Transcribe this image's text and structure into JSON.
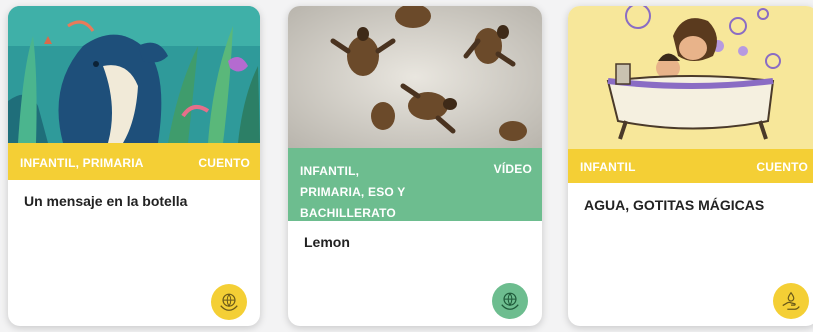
{
  "cards": [
    {
      "levels": "INFANTIL, PRIMARIA",
      "type": "CUENTO",
      "title": "Un mensaje en la botella",
      "band_color": "#f4cf35",
      "icon": "globe-hands-icon"
    },
    {
      "levels": "INFANTIL, PRIMARIA, ESO Y BACHILLERATO",
      "type": "VÍDEO",
      "title": "Lemon",
      "band_color": "#6dbd8f",
      "icon": "globe-hands-icon"
    },
    {
      "levels": "INFANTIL",
      "type": "CUENTO",
      "title": "AGUA, GOTITAS MÁGICAS",
      "band_color": "#f4cf35",
      "icon": "hand-water-icon"
    }
  ]
}
